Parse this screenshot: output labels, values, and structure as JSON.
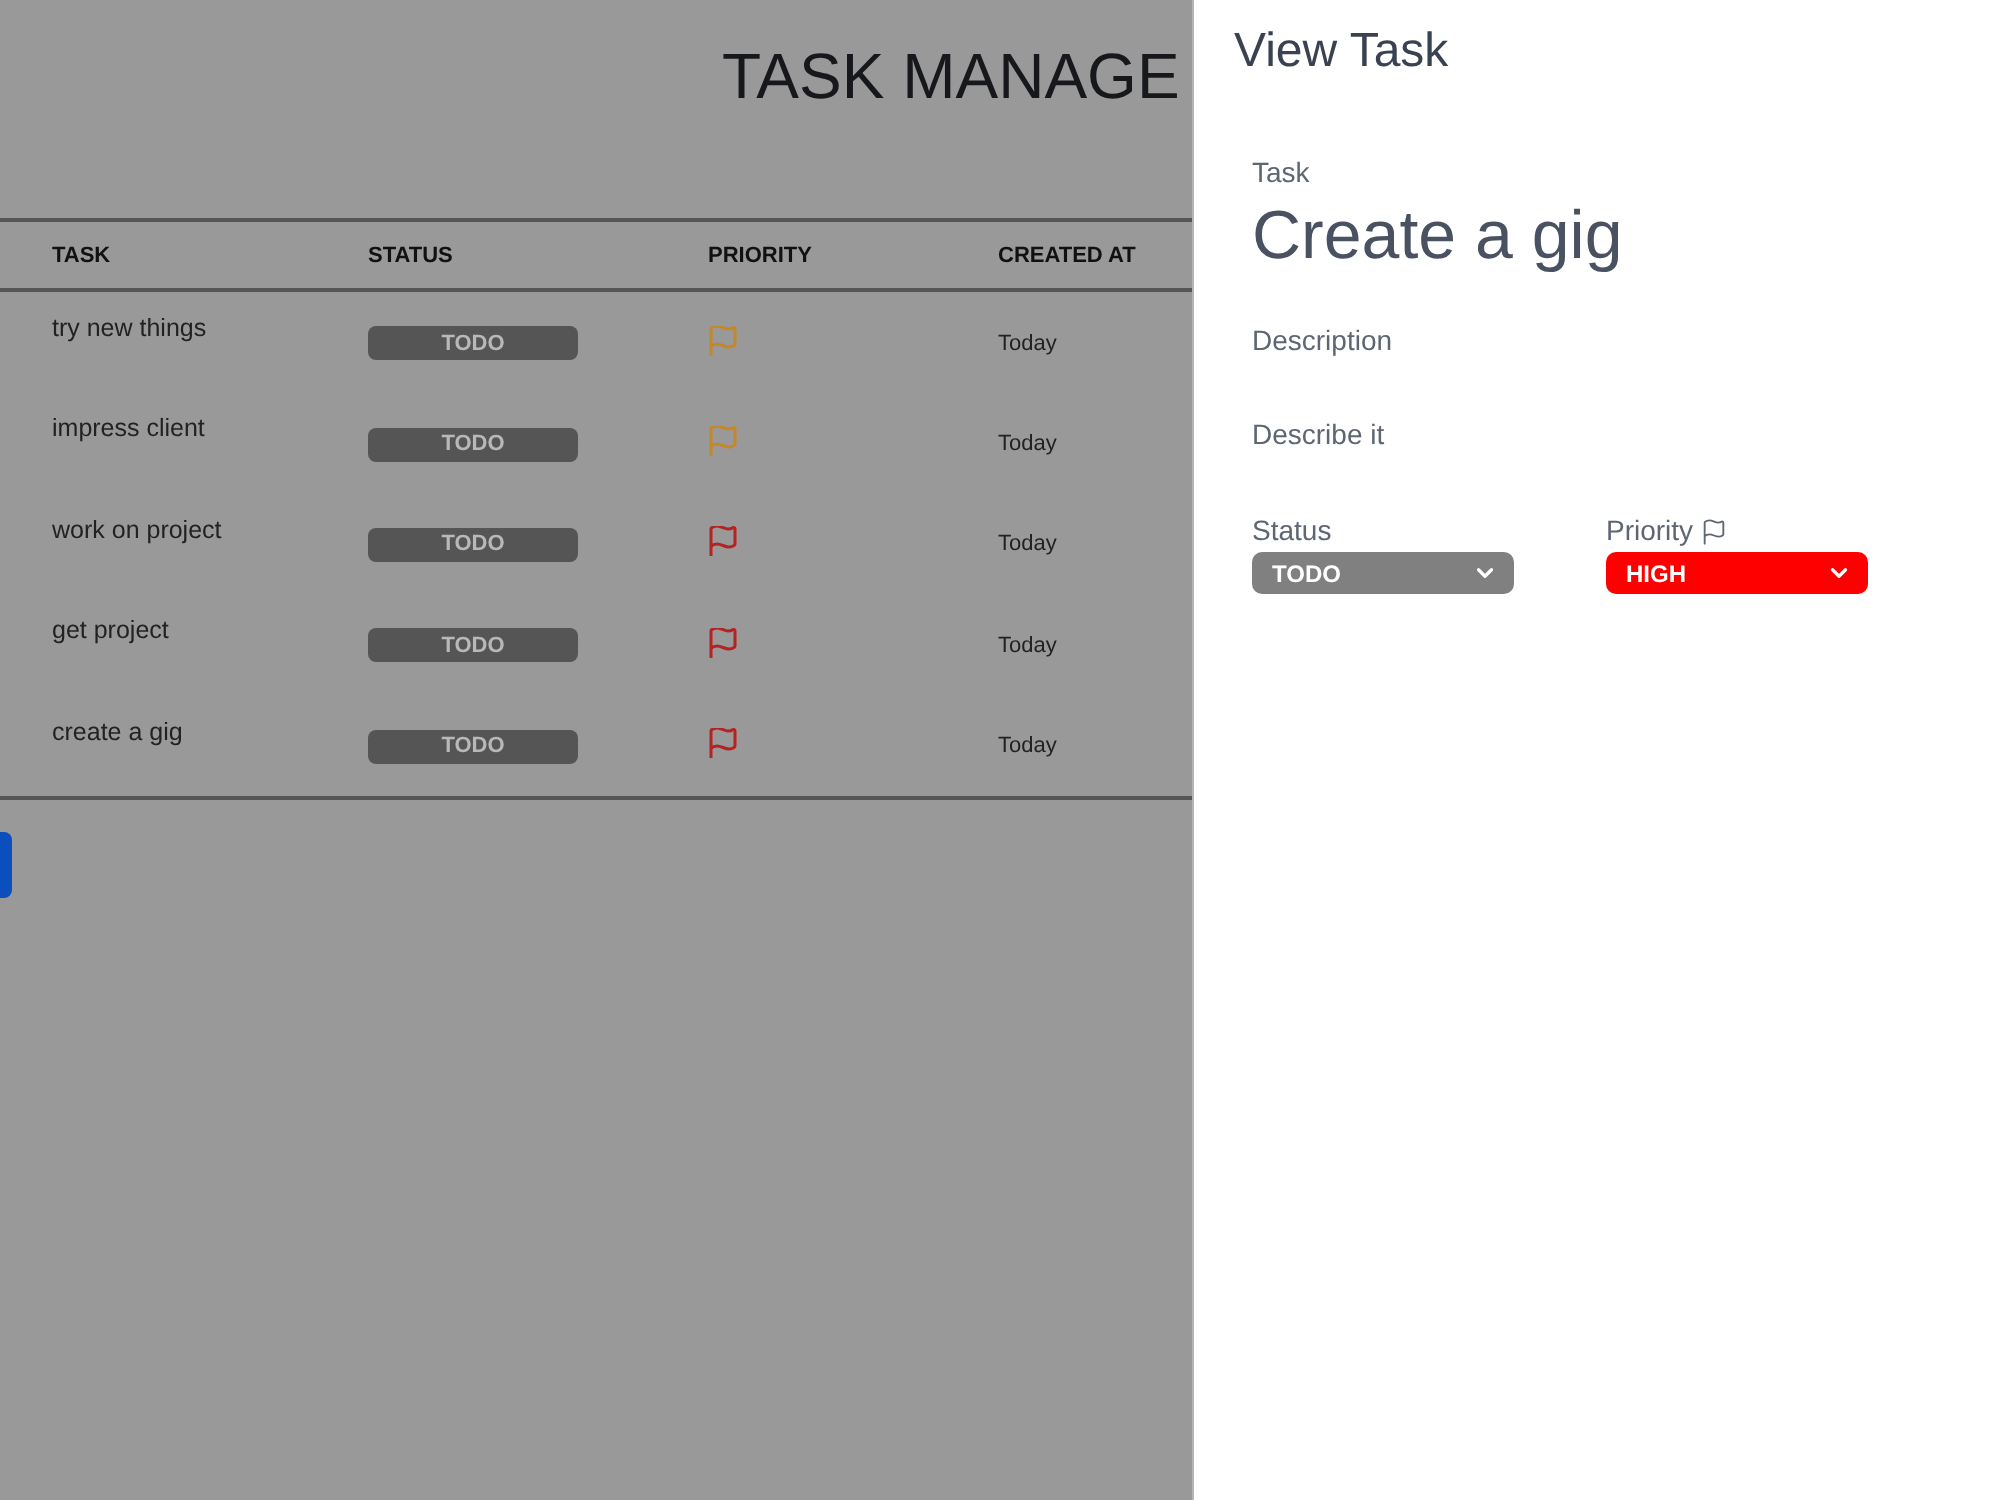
{
  "header": {
    "title": "TASK MANAGE"
  },
  "table": {
    "columns": [
      "TASK",
      "STATUS",
      "PRIORITY",
      "CREATED AT"
    ],
    "rows": [
      {
        "task": "try new things",
        "status": "TODO",
        "color": "#c4882a",
        "created_at": "Today"
      },
      {
        "task": "impress client",
        "status": "TODO",
        "color": "#c4882a",
        "created_at": "Today"
      },
      {
        "task": "work on project",
        "status": "TODO",
        "color": "#b52222",
        "created_at": "Today"
      },
      {
        "task": "get project",
        "status": "TODO",
        "color": "#b52222",
        "created_at": "Today"
      },
      {
        "task": "create a gig",
        "status": "TODO",
        "color": "#b52222",
        "created_at": "Today"
      }
    ]
  },
  "panel": {
    "title": "View Task",
    "task_label": "Task",
    "task_name": "Create a gig",
    "description_label": "Description",
    "description": {
      "placeholder": "Describe it"
    },
    "status": {
      "label": "Status",
      "value": "TODO",
      "color": "#808080"
    },
    "priority": {
      "label": "Priority",
      "value": "HIGH",
      "color": "#ff0000"
    }
  }
}
